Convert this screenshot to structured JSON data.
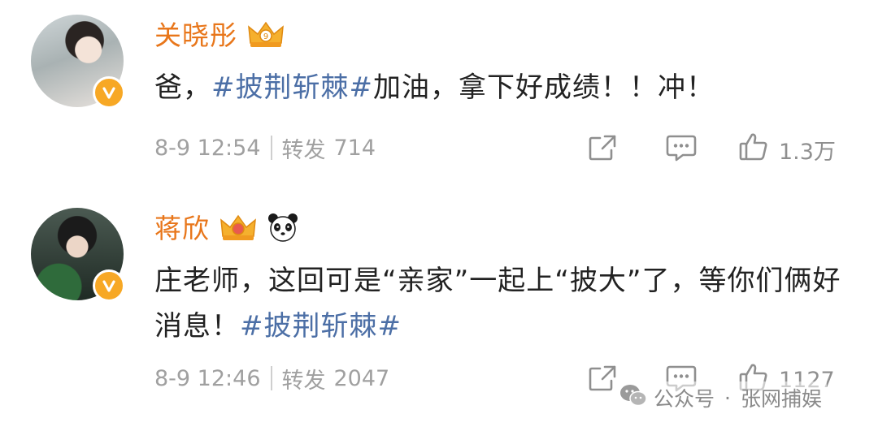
{
  "posts": [
    {
      "user_name": "关晓彤",
      "badges": [
        "vip-crown-icon"
      ],
      "verified": true,
      "text_parts": [
        {
          "type": "text",
          "value": "爸，"
        },
        {
          "type": "topic",
          "value": "#披荆斩棘#"
        },
        {
          "type": "text",
          "value": "加油，拿下好成绩！！冲！"
        }
      ],
      "time": "8-9 12:54",
      "repost_label": "转发",
      "repost_count": "714",
      "like_count": "1.3万"
    },
    {
      "user_name": "蒋欣",
      "badges": [
        "vip-crown-icon",
        "panda-icon"
      ],
      "verified": true,
      "text_parts": [
        {
          "type": "text",
          "value": "庄老师，这回可是“亲家”一起上“披大”了，等你们俩好消息！"
        },
        {
          "type": "topic",
          "value": "#披荆斩棘#"
        }
      ],
      "time": "8-9 12:46",
      "repost_label": "转发",
      "repost_count": "2047",
      "like_count": "1127"
    }
  ],
  "watermark": {
    "prefix": "公众号",
    "separator": "·",
    "name": "张网捕娱"
  },
  "colors": {
    "name": "#e8761a",
    "topic": "#4c6fa6",
    "text": "#222222",
    "meta": "#a0a0a0",
    "verified_badge": "#f7a825"
  }
}
